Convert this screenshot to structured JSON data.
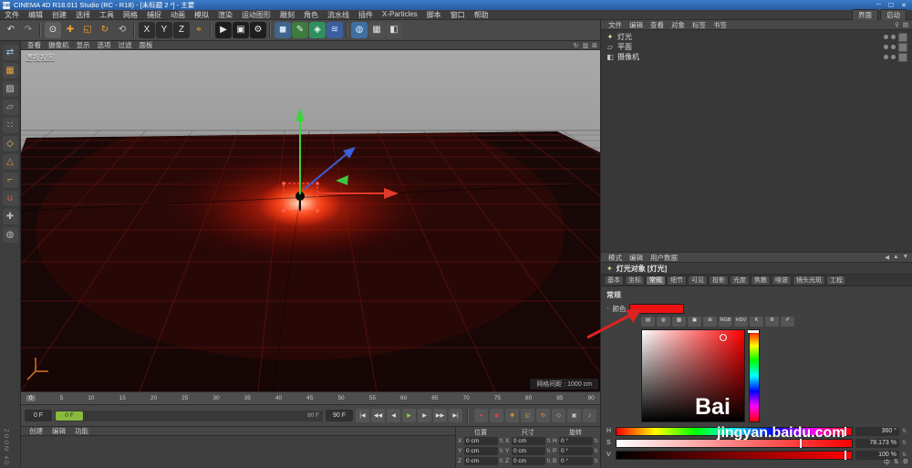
{
  "colors": {
    "titlebar": "#2f6ab8",
    "accent_red": "#e01010",
    "swatch_red": "#ee1212"
  },
  "title_bar": {
    "title": "CINEMA 4D R18.011 Studio (RC - R18) - [未标题 2 *] - 主要",
    "logo": "C4D",
    "controls": [
      "─",
      "☐",
      "✕"
    ]
  },
  "menu_bar": {
    "items": [
      "文件",
      "编辑",
      "创建",
      "选择",
      "工具",
      "网格",
      "捕捉",
      "动画",
      "模拟",
      "渲染",
      "运动图形",
      "雕刻",
      "角色",
      "流水线",
      "插件",
      "X-Particles",
      "脚本",
      "窗口",
      "帮助"
    ],
    "right_items": [
      "界面",
      "启动"
    ]
  },
  "toolbar": {
    "icons": [
      {
        "name": "undo-icon",
        "glyph": "↶",
        "fg": "#dcdcdc",
        "bg": ""
      },
      {
        "name": "redo-icon",
        "glyph": "↷",
        "fg": "#9a9a9a",
        "bg": ""
      },
      {
        "name": "separator",
        "glyph": "",
        "fg": "",
        "bg": ""
      },
      {
        "name": "live-selection-icon",
        "glyph": "⊙",
        "fg": "#f0f0f0",
        "bg": "#5e5e5e"
      },
      {
        "name": "move-tool-icon",
        "glyph": "✚",
        "fg": "#f0a135",
        "bg": ""
      },
      {
        "name": "scale-tool-icon",
        "glyph": "◱",
        "fg": "#f0a135",
        "bg": ""
      },
      {
        "name": "rotate-tool-icon",
        "glyph": "↻",
        "fg": "#f0a135",
        "bg": ""
      },
      {
        "name": "last-tool-icon",
        "glyph": "⟲",
        "fg": "#c0c0c0",
        "bg": ""
      },
      {
        "name": "separator",
        "glyph": "",
        "fg": "",
        "bg": ""
      },
      {
        "name": "lock-x-axis-icon",
        "glyph": "X",
        "fg": "#e8e8e8",
        "bg": "#2d2d2d"
      },
      {
        "name": "lock-y-axis-icon",
        "glyph": "Y",
        "fg": "#e8e8e8",
        "bg": "#2d2d2d"
      },
      {
        "name": "lock-z-axis-icon",
        "glyph": "Z",
        "fg": "#e8e8e8",
        "bg": "#2d2d2d"
      },
      {
        "name": "coordinate-system-icon",
        "glyph": "⌖",
        "fg": "#f0a135",
        "bg": ""
      },
      {
        "name": "separator",
        "glyph": "",
        "fg": "",
        "bg": ""
      },
      {
        "name": "render-view-icon",
        "glyph": "▶",
        "fg": "#e8e8e8",
        "bg": "#1e1e1e"
      },
      {
        "name": "render-picture-viewer-icon",
        "glyph": "▣",
        "fg": "#e8e8e8",
        "bg": "#1e1e1e"
      },
      {
        "name": "render-settings-icon",
        "glyph": "⚙",
        "fg": "#e8e8e8",
        "bg": "#1e1e1e"
      },
      {
        "name": "separator",
        "glyph": "",
        "fg": "",
        "bg": ""
      },
      {
        "name": "primitive-cube-icon",
        "glyph": "◼",
        "fg": "#cfe2f5",
        "bg": "#41658c"
      },
      {
        "name": "spline-pen-icon",
        "glyph": "✎",
        "fg": "#eaf5ea",
        "bg": "#3f7a3f"
      },
      {
        "name": "mograph-icon",
        "glyph": "◈",
        "fg": "#eafff0",
        "bg": "#2f8f5f"
      },
      {
        "name": "deformer-icon",
        "glyph": "≋",
        "fg": "#d5e5fa",
        "bg": "#3a5fa0"
      },
      {
        "name": "separator",
        "glyph": "",
        "fg": "",
        "bg": ""
      },
      {
        "name": "environment-icon",
        "glyph": "◍",
        "fg": "#d8ecff",
        "bg": "#3f6f9f"
      },
      {
        "name": "camera-icon",
        "glyph": "▦",
        "fg": "#e0e0e0",
        "bg": "#4f4f4f"
      },
      {
        "name": "display-mode-icon",
        "glyph": "◧",
        "fg": "#e0e0e0",
        "bg": "#4f4f4f"
      }
    ]
  },
  "left_rail": {
    "icons": [
      {
        "name": "convert-mode-icon",
        "glyph": "⇄",
        "fg": "#9ec7e8"
      },
      {
        "name": "model-mode-icon",
        "glyph": "▦",
        "fg": "#e8a040"
      },
      {
        "name": "texture-mode-icon",
        "glyph": "▨",
        "fg": "#c8c8c8"
      },
      {
        "name": "workplane-mode-icon",
        "glyph": "▱",
        "fg": "#b0b0b0"
      },
      {
        "name": "points-mode-icon",
        "glyph": "∷",
        "fg": "#c9a0e8"
      },
      {
        "name": "edges-mode-icon",
        "glyph": "◇",
        "fg": "#e8c060"
      },
      {
        "name": "polygons-mode-icon",
        "glyph": "△",
        "fg": "#e89040"
      },
      {
        "name": "axis-mode-icon",
        "glyph": "⌐",
        "fg": "#e8b040"
      },
      {
        "name": "snap-mode-icon",
        "glyph": "∪",
        "fg": "#e86040"
      },
      {
        "name": "workplane-lock-icon",
        "glyph": "✚",
        "fg": "#b8b8b8"
      },
      {
        "name": "solo-mode-icon",
        "glyph": "◍",
        "fg": "#b8b8b8"
      }
    ]
  },
  "viewport": {
    "label": "透视视图",
    "menu": [
      "查看",
      "摄像机",
      "显示",
      "选项",
      "过滤",
      "面板"
    ],
    "corner_icons": [
      "↻",
      "▥",
      "⊞"
    ],
    "grid_spacing": "网格间距 : 1000 cm"
  },
  "timeline": {
    "frames": [
      "0",
      "5",
      "10",
      "15",
      "20",
      "25",
      "30",
      "35",
      "40",
      "45",
      "50",
      "55",
      "60",
      "65",
      "70",
      "75",
      "80",
      "85",
      "90"
    ]
  },
  "transport": {
    "current": "0 F",
    "range_end": "90 F",
    "play_buttons": [
      {
        "name": "goto-start-button",
        "glyph": "|◀"
      },
      {
        "name": "prev-key-button",
        "glyph": "◀◀"
      },
      {
        "name": "prev-frame-button",
        "glyph": "◀"
      },
      {
        "name": "play-button",
        "glyph": "▶"
      },
      {
        "name": "next-frame-button",
        "glyph": "▶"
      },
      {
        "name": "next-key-button",
        "glyph": "▶▶"
      },
      {
        "name": "goto-end-button",
        "glyph": "▶|"
      }
    ],
    "record_buttons": [
      {
        "name": "record-button",
        "glyph": "●",
        "color": "#e04545"
      },
      {
        "name": "autokey-button",
        "glyph": "◉",
        "color": "#e04545"
      },
      {
        "name": "keyframe-position-button",
        "glyph": "✚",
        "color": "#e8a040"
      },
      {
        "name": "keyframe-scale-button",
        "glyph": "◱",
        "color": "#e8a040"
      },
      {
        "name": "keyframe-rotation-button",
        "glyph": "↻",
        "color": "#e8a040"
      },
      {
        "name": "keyframe-parameter-button",
        "glyph": "◇",
        "color": "#c8c8c8"
      },
      {
        "name": "keyframe-pla-button",
        "glyph": "▣",
        "color": "#c8c8c8"
      },
      {
        "name": "sound-button",
        "glyph": "♪",
        "color": "#c8c8c8"
      }
    ]
  },
  "object_manager": {
    "menu": [
      "文件",
      "编辑",
      "查看",
      "对象",
      "标签",
      "书签"
    ],
    "corner_icons": [
      "⚲",
      "▤"
    ],
    "objects": [
      {
        "name": "灯光",
        "icon": "light-icon",
        "glyph": "✦",
        "color": "#e8e0a0"
      },
      {
        "name": "平面",
        "icon": "plane-icon",
        "glyph": "▱",
        "color": "#9ec7e8"
      },
      {
        "name": "摄像机",
        "icon": "camera-icon",
        "glyph": "◧",
        "color": "#c8c8c8"
      }
    ]
  },
  "attribute_manager": {
    "menu": [
      "模式",
      "编辑",
      "用户数据"
    ],
    "corner_icons": [
      "◀",
      "▲",
      "▼"
    ],
    "title": "灯光对象 [灯光]",
    "tabs": [
      "基本",
      "坐标",
      "常规",
      "细节",
      "可见",
      "投影",
      "光度",
      "焦散",
      "噪波",
      "镜头光斑",
      "工程"
    ],
    "active_tab": "常规",
    "section": "常规",
    "color_label": "颜色",
    "picker_toolbar": [
      {
        "name": "compact-mode-icon",
        "glyph": "▤"
      },
      {
        "name": "wheel-mode-icon",
        "glyph": "◍"
      },
      {
        "name": "spectrum-mode-icon",
        "glyph": "▩"
      },
      {
        "name": "image-mode-icon",
        "glyph": "▣"
      },
      {
        "name": "swatch-mode-icon",
        "glyph": "⊞"
      },
      {
        "name": "rgb-mode-icon",
        "glyph": "RGB"
      },
      {
        "name": "hsv-mode-icon",
        "glyph": "HSV"
      },
      {
        "name": "kelvin-mode-icon",
        "glyph": "K"
      },
      {
        "name": "mixer-mode-icon",
        "glyph": "≣"
      },
      {
        "name": "eyedropper-icon",
        "glyph": "✐"
      }
    ],
    "sliders": [
      {
        "label": "H",
        "value": "360 °",
        "track": "hue",
        "pos": "97%"
      },
      {
        "label": "S",
        "value": "78.173 %",
        "track": "sat",
        "pos": "78%"
      },
      {
        "label": "V",
        "value": "100 %",
        "track": "val",
        "pos": "97%"
      }
    ]
  },
  "coordinates": {
    "groups": [
      {
        "title": "位置",
        "rows": [
          {
            "axis": "X",
            "value": "0 cm"
          },
          {
            "axis": "Y",
            "value": "0 cm"
          },
          {
            "axis": "Z",
            "value": "0 cm"
          }
        ]
      },
      {
        "title": "尺寸",
        "rows": [
          {
            "axis": "X",
            "value": "0 cm"
          },
          {
            "axis": "Y",
            "value": "0 cm"
          },
          {
            "axis": "Z",
            "value": "0 cm"
          }
        ]
      },
      {
        "title": "旋转",
        "rows": [
          {
            "axis": "H",
            "value": "0 °"
          },
          {
            "axis": "P",
            "value": "0 °"
          },
          {
            "axis": "B",
            "value": "0 °"
          }
        ]
      }
    ]
  },
  "material_manager": {
    "menu": [
      "创建",
      "编辑",
      "功能"
    ]
  },
  "watermark": {
    "big": "Bai",
    "small": "jingyan.baidu.com",
    "corner": "ZOOM 4D"
  },
  "status_bar": {
    "items": [
      "中",
      "⇅",
      "⚙"
    ]
  }
}
